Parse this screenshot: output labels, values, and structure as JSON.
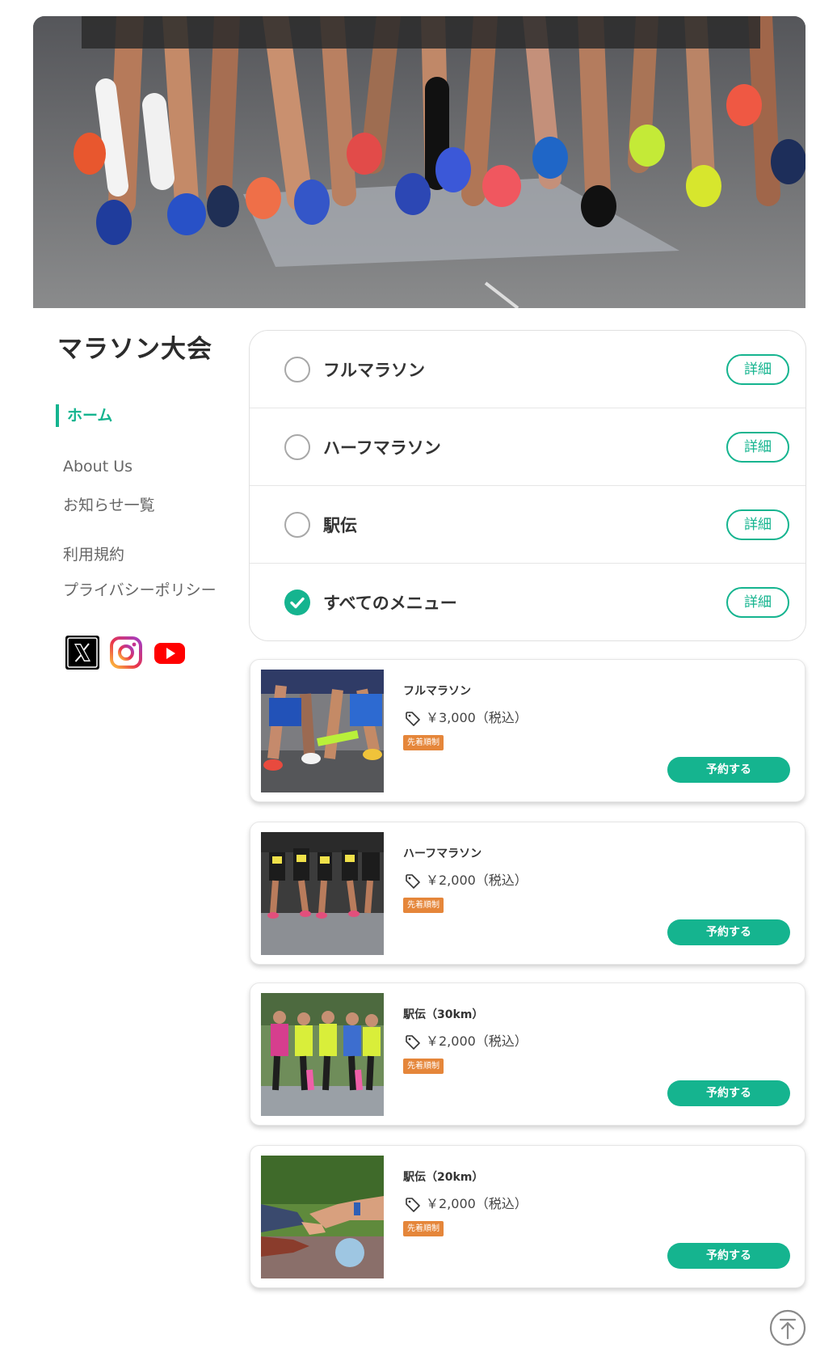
{
  "site": {
    "title": "マラソン大会"
  },
  "nav": {
    "home": "ホーム",
    "about": "About Us",
    "news": "お知らせ一覧",
    "terms": "利用規約",
    "privacy": "プライバシーポリシー"
  },
  "social": [
    "x-icon",
    "instagram-icon",
    "youtube-icon"
  ],
  "categories": [
    {
      "label": "フルマラソン",
      "detail": "詳細",
      "checked": false
    },
    {
      "label": "ハーフマラソン",
      "detail": "詳細",
      "checked": false
    },
    {
      "label": "駅伝",
      "detail": "詳細",
      "checked": false
    },
    {
      "label": "すべてのメニュー",
      "detail": "詳細",
      "checked": true
    }
  ],
  "products": [
    {
      "name": "フルマラソン",
      "price": "￥3,000（税込）",
      "badge": "先着順制",
      "button": "予約する"
    },
    {
      "name": "ハーフマラソン",
      "price": "￥2,000（税込）",
      "badge": "先着順制",
      "button": "予約する"
    },
    {
      "name": "駅伝（30km）",
      "price": "￥2,000（税込）",
      "badge": "先着順制",
      "button": "予約する"
    },
    {
      "name": "駅伝（20km）",
      "price": "￥2,000（税込）",
      "badge": "先着順制",
      "button": "予約する"
    }
  ],
  "colors": {
    "accent": "#15b48f",
    "badge": "#e5863a"
  }
}
